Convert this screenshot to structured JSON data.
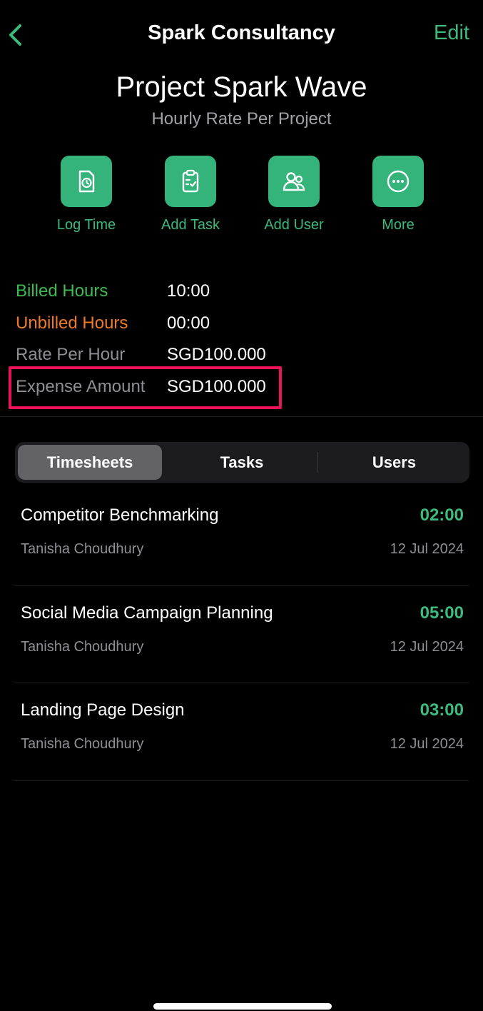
{
  "nav": {
    "back_icon": "chevron-left-icon",
    "title": "Spark Consultancy",
    "edit_label": "Edit"
  },
  "project": {
    "title": "Project Spark Wave",
    "subtitle": "Hourly Rate Per Project"
  },
  "actions": [
    {
      "label": "Log Time",
      "icon": "clipboard-clock-icon"
    },
    {
      "label": "Add Task",
      "icon": "clipboard-check-icon"
    },
    {
      "label": "Add User",
      "icon": "users-icon"
    },
    {
      "label": "More",
      "icon": "ellipsis-circle-icon"
    }
  ],
  "stats": [
    {
      "label": "Billed Hours",
      "value": "10:00",
      "color": "#3dbb4e"
    },
    {
      "label": "Unbilled Hours",
      "value": "00:00",
      "color": "#f07a23"
    },
    {
      "label": "Rate Per Hour",
      "value": "SGD100.000",
      "color": "#8e8e93"
    },
    {
      "label": "Expense Amount",
      "value": "SGD100.000",
      "color": "#8e8e93"
    }
  ],
  "tabs": {
    "items": [
      "Timesheets",
      "Tasks",
      "Users"
    ],
    "selected": "Timesheets"
  },
  "timesheets": [
    {
      "title": "Competitor Benchmarking",
      "user": "Tanisha Choudhury",
      "date": "12 Jul 2024",
      "time": "02:00"
    },
    {
      "title": "Social Media Campaign Planning",
      "user": "Tanisha Choudhury",
      "date": "12 Jul 2024",
      "time": "05:00"
    },
    {
      "title": "Landing Page Design",
      "user": "Tanisha Choudhury",
      "date": "12 Jul 2024",
      "time": "03:00"
    }
  ],
  "colors": {
    "accent": "#3dbb7d",
    "tile": "#34b47a",
    "highlight": "#e8145a",
    "billed": "#3dbb4e",
    "unbilled": "#f07a23"
  }
}
